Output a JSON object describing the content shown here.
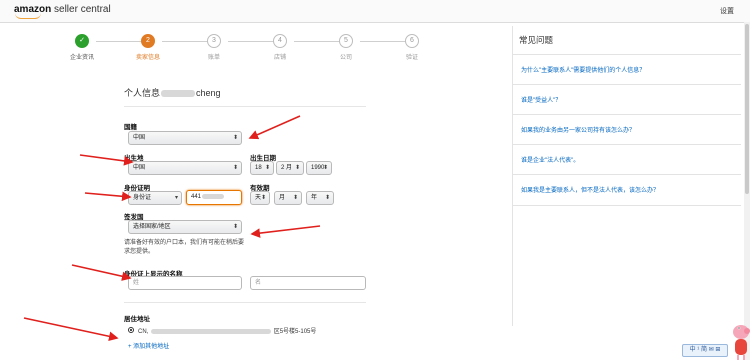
{
  "header": {
    "logo_amazon": "amazon",
    "logo_rest": " seller central",
    "settings": "设置"
  },
  "steps": [
    {
      "num": "✓",
      "label": "企业资讯",
      "state": "done"
    },
    {
      "num": "2",
      "label": "卖家信息",
      "state": "active"
    },
    {
      "num": "3",
      "label": "账单",
      "state": "todo"
    },
    {
      "num": "4",
      "label": "店铺",
      "state": "todo"
    },
    {
      "num": "5",
      "label": "公司",
      "state": "todo"
    },
    {
      "num": "6",
      "label": "验证",
      "state": "todo"
    }
  ],
  "form": {
    "heading_prefix": "个人信息",
    "heading_suffix": "cheng",
    "nationality_label": "国籍",
    "nationality_value": "中国",
    "birthplace_label": "出生地",
    "birthplace_value": "中国",
    "dob_label": "出生日期",
    "dob_day": "18",
    "dob_month": "2 月",
    "dob_year": "1990",
    "id_label": "身份证明",
    "id_type": "身份证",
    "id_number": "441",
    "expiry_label": "有效期",
    "expiry_day": "天",
    "expiry_month": "月",
    "expiry_year": "年",
    "issuer_label": "签发国",
    "issuer_value": "选择国家/地区",
    "note": "请准备好有效的户口本，我们有可能在稍后要求您提供。",
    "name_label": "身份证上显示的名称",
    "first_name_placeholder": "姓",
    "last_name_placeholder": "名",
    "address_label": "居住地址",
    "address_prefix": "CN,",
    "address_suffix": "区5号楼5-105号",
    "add_address_link": "+ 添加其他地址"
  },
  "faq": {
    "title": "常见问题",
    "items": [
      "为什么\"主要联系人\"需要提供他们的个人信息？",
      "谁是\"受益人\"？",
      "如果我的业务由另一家公司持有该怎么办？",
      "谁是企业\"法人代表\"。",
      "如果我是主要联系人，但不是法人代表，该怎么办？"
    ]
  },
  "ime": {
    "label": "中 ¹ 简 ✉ ⊞"
  },
  "colors": {
    "accent_orange": "#e07b24",
    "done_green": "#2ca02c",
    "link_blue": "#0066c0",
    "annotation_red": "#e0201c"
  }
}
